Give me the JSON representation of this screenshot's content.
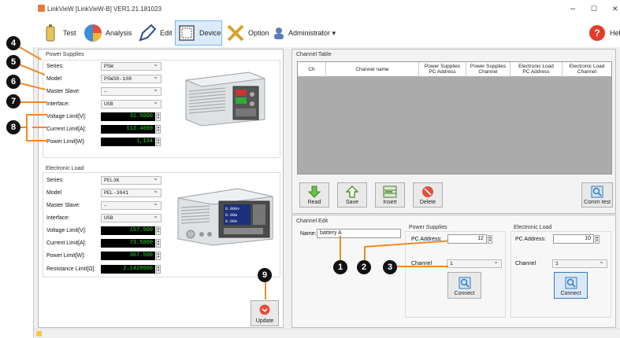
{
  "title": "LinkVieW [LinkVieW-B] VER1.21.181023",
  "window": {
    "minimize": "–",
    "maximize": "☐",
    "close": "✕"
  },
  "toolbar": {
    "test": "Test",
    "analysis": "Analysis",
    "edit": "Edit",
    "device": "Device",
    "option": "Option",
    "admin": "Administrator ▾",
    "help": "Hel"
  },
  "power": {
    "title": "Power Supplies",
    "series_label": "Series:",
    "series": "PSW",
    "model_label": "Model",
    "model": "PSW30-108",
    "slave_label": "Master Slave:",
    "slave": "–",
    "interface_label": "Interface:",
    "interface": "USB",
    "voltage_label": "Voltage Limit[V]:",
    "voltage": "31.5000",
    "current_label": "Current Limit[A]:",
    "current": "113.4000",
    "power_label": "Power Limit[W]:",
    "power": "1,134"
  },
  "load": {
    "title": "Electronic Load",
    "series_label": "Series:",
    "series": "PEL3K",
    "model_label": "Model",
    "model": "PEL-3041",
    "slave_label": "Master Slave:",
    "slave": "–",
    "interface_label": "Interface:",
    "interface": "USB",
    "voltage_label": "Voltage Limit[V]:",
    "voltage": "157.500",
    "current_label": "Current Limit[A]:",
    "current": "73.5000",
    "power_label": "Power Limit[W]:",
    "power": "367.500",
    "resistance_label": "Resistance Limit[Ω]:",
    "resistance": "2.1428600"
  },
  "update_label": "Update",
  "channel_table": {
    "title": "Channel Table",
    "headers": [
      "Ch",
      "Channel name",
      "Power Supplies\nPC Address",
      "Power Supplies\nChannel",
      "Electronic Load\nPC Address",
      "Electronic Load\nChannel"
    ]
  },
  "actions": {
    "read": "Read",
    "save": "Save",
    "insert": "Insert",
    "delete": "Delete",
    "comm_test": "Comm test"
  },
  "channel_edit": {
    "title": "Channel Edit",
    "name_label": "Name:",
    "name": "battery A",
    "ps_title": "Power Supplies",
    "ps_addr_label": "PC Address:",
    "ps_addr": "12",
    "ps_channel_label": "Channel",
    "ps_channel": "1",
    "el_title": "Electronic Load",
    "el_addr_label": "PC Address:",
    "el_addr": "10",
    "el_channel_label": "Channel",
    "el_channel": "1",
    "connect": "Connect"
  },
  "device_display": {
    "volts": "0.000v",
    "watts": "0.00w",
    "amps": "0.00A"
  },
  "badges": [
    "1",
    "2",
    "3",
    "4",
    "5",
    "6",
    "7",
    "8",
    "9"
  ]
}
